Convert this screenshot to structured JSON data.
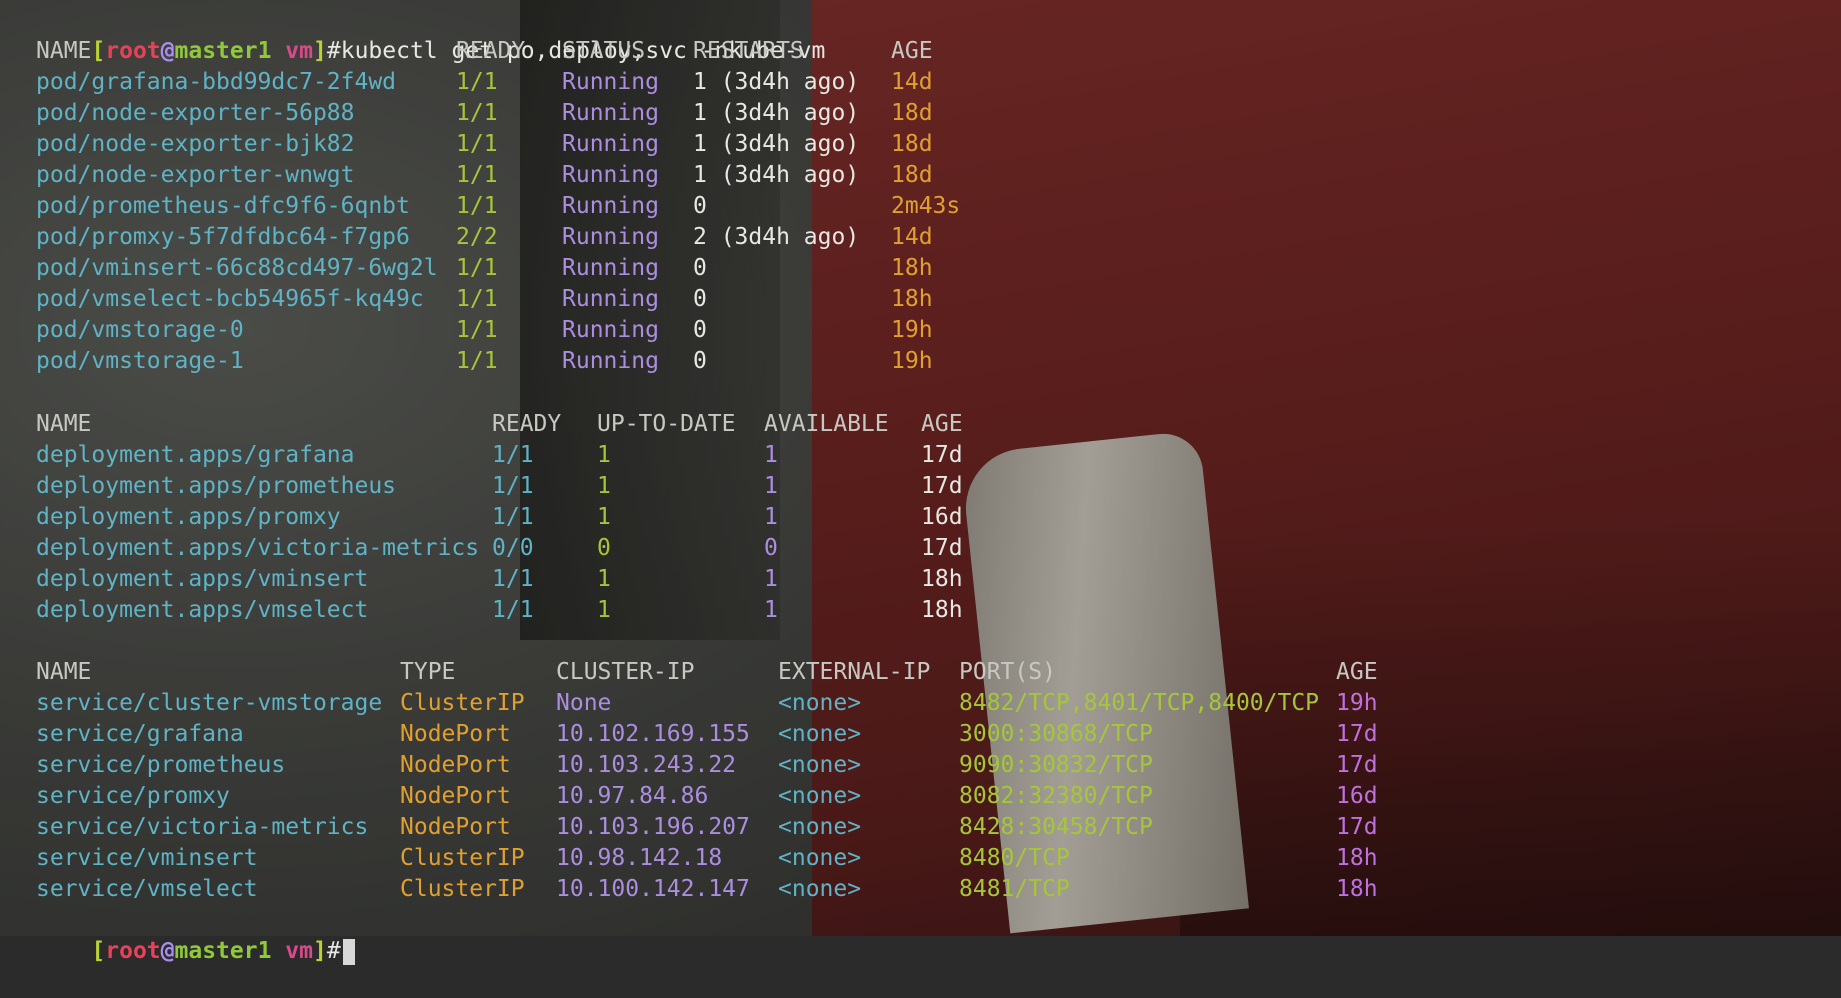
{
  "prompt": {
    "open": "[",
    "user": "root",
    "at": "@",
    "host": "master1",
    "dir": "vm",
    "close": "]",
    "hash": "#"
  },
  "command": "kubectl get po,deploy,svc -nkube-vm",
  "pods": {
    "headers": [
      "NAME",
      "READY",
      "STATUS",
      "RESTARTS",
      "AGE"
    ],
    "rows": [
      [
        "pod/grafana-bbd99dc7-2f4wd",
        "1/1",
        "Running",
        "1 (3d4h ago)",
        "14d"
      ],
      [
        "pod/node-exporter-56p88",
        "1/1",
        "Running",
        "1 (3d4h ago)",
        "18d"
      ],
      [
        "pod/node-exporter-bjk82",
        "1/1",
        "Running",
        "1 (3d4h ago)",
        "18d"
      ],
      [
        "pod/node-exporter-wnwgt",
        "1/1",
        "Running",
        "1 (3d4h ago)",
        "18d"
      ],
      [
        "pod/prometheus-dfc9f6-6qnbt",
        "1/1",
        "Running",
        "0",
        "2m43s"
      ],
      [
        "pod/promxy-5f7dfdbc64-f7gp6",
        "2/2",
        "Running",
        "2 (3d4h ago)",
        "14d"
      ],
      [
        "pod/vminsert-66c88cd497-6wg2l",
        "1/1",
        "Running",
        "0",
        "18h"
      ],
      [
        "pod/vmselect-bcb54965f-kq49c",
        "1/1",
        "Running",
        "0",
        "18h"
      ],
      [
        "pod/vmstorage-0",
        "1/1",
        "Running",
        "0",
        "19h"
      ],
      [
        "pod/vmstorage-1",
        "1/1",
        "Running",
        "0",
        "19h"
      ]
    ]
  },
  "deployments": {
    "headers": [
      "NAME",
      "READY",
      "UP-TO-DATE",
      "AVAILABLE",
      "AGE"
    ],
    "rows": [
      [
        "deployment.apps/grafana",
        "1/1",
        "1",
        "1",
        "17d"
      ],
      [
        "deployment.apps/prometheus",
        "1/1",
        "1",
        "1",
        "17d"
      ],
      [
        "deployment.apps/promxy",
        "1/1",
        "1",
        "1",
        "16d"
      ],
      [
        "deployment.apps/victoria-metrics",
        "0/0",
        "0",
        "0",
        "17d"
      ],
      [
        "deployment.apps/vminsert",
        "1/1",
        "1",
        "1",
        "18h"
      ],
      [
        "deployment.apps/vmselect",
        "1/1",
        "1",
        "1",
        "18h"
      ]
    ]
  },
  "services": {
    "headers": [
      "NAME",
      "TYPE",
      "CLUSTER-IP",
      "EXTERNAL-IP",
      "PORT(S)",
      "AGE"
    ],
    "rows": [
      [
        "service/cluster-vmstorage",
        "ClusterIP",
        "None",
        "<none>",
        "8482/TCP,8401/TCP,8400/TCP",
        "19h"
      ],
      [
        "service/grafana",
        "NodePort",
        "10.102.169.155",
        "<none>",
        "3000:30868/TCP",
        "17d"
      ],
      [
        "service/prometheus",
        "NodePort",
        "10.103.243.22",
        "<none>",
        "9090:30832/TCP",
        "17d"
      ],
      [
        "service/promxy",
        "NodePort",
        "10.97.84.86",
        "<none>",
        "8082:32380/TCP",
        "16d"
      ],
      [
        "service/victoria-metrics",
        "NodePort",
        "10.103.196.207",
        "<none>",
        "8428:30458/TCP",
        "17d"
      ],
      [
        "service/vminsert",
        "ClusterIP",
        "10.98.142.18",
        "<none>",
        "8480/TCP",
        "18h"
      ],
      [
        "service/vmselect",
        "ClusterIP",
        "10.100.142.147",
        "<none>",
        "8481/TCP",
        "18h"
      ]
    ]
  },
  "colors": {
    "name": "#5fb3c6",
    "ready": "#a6c63a",
    "status": "#ab8ee0",
    "age_pod": "#e0a030",
    "type": "#e0a030",
    "cluster_ip": "#ab8ee0",
    "external_ip": "#5fb3c6",
    "ports": "#a6c63a",
    "age_svc": "#c070e0"
  }
}
